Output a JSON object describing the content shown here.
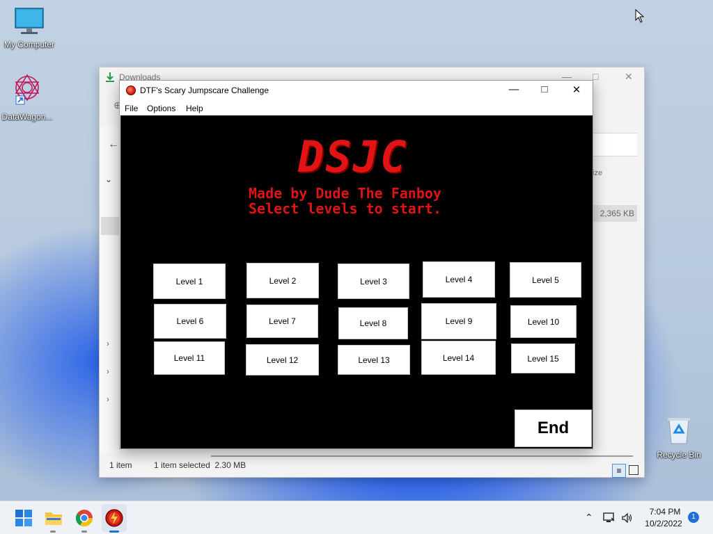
{
  "desktop": {
    "icons": [
      {
        "label": "My Computer"
      },
      {
        "label": "DataWagon..."
      },
      {
        "label": "Recycle Bin"
      }
    ]
  },
  "explorer": {
    "title": "Downloads",
    "size_value": "2,365 KB",
    "column_fragment": "ize",
    "status_items": "1 item",
    "status_selected": "1 item selected  2.30 MB"
  },
  "game": {
    "title": "DTF's Scary Jumpscare Challenge",
    "menu": [
      "File",
      "Options",
      "Help"
    ],
    "logo": "DSJC",
    "subtitle_line1": "Made by Dude The Fanboy",
    "subtitle_line2": "Select levels to start.",
    "levels": [
      "Level 1",
      "Level 2",
      "Level 3",
      "Level 4",
      "Level 5",
      "Level 6",
      "Level 7",
      "Level 8",
      "Level 9",
      "Level 10",
      "Level 11",
      "Level 12",
      "Level 13",
      "Level 14",
      "Level 15"
    ],
    "end_label": "End"
  },
  "taskbar": {
    "time": "7:04 PM",
    "date": "10/2/2022",
    "notification_count": "1"
  },
  "colors": {
    "game_accent": "#e01414",
    "canvas_bg": "#000000",
    "taskbar_bg": "#eef2f7"
  }
}
